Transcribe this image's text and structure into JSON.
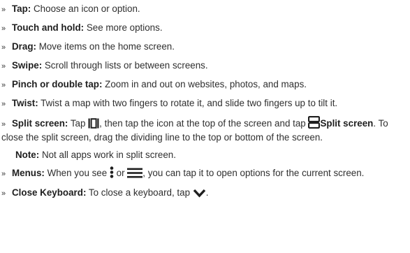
{
  "items": [
    {
      "bullet": "»",
      "term": "Tap:",
      "text": " Choose an icon or option."
    },
    {
      "bullet": "»",
      "term": "Touch and hold:",
      "text": " See more options."
    },
    {
      "bullet": "»",
      "term": "Drag:",
      "text": " Move items on the home screen."
    },
    {
      "bullet": "»",
      "term": "Swipe:",
      "text": " Scroll through lists or between screens."
    },
    {
      "bullet": "»",
      "term": "Pinch or double tap:",
      "text": " Zoom in and out on websites, photos, and maps."
    },
    {
      "bullet": "»",
      "term": "Twist:",
      "text": " Twist a map with two fingers to rotate it, and slide two fingers up to tilt it."
    }
  ],
  "split_screen": {
    "bullet": "»",
    "term": "Split screen:",
    "text_1": " Tap ",
    "text_2": ", then tap the icon at the top of the screen and tap ",
    "term_2": "Split screen",
    "text_3": ". To close the split screen, drag the dividing line to the top or bottom of the screen.",
    "icon_1": "recent-apps-icon",
    "icon_2": "split-screen-icon"
  },
  "note": {
    "label": "Note:",
    "text": " Not all apps work in split screen."
  },
  "menus": {
    "bullet": "»",
    "term": "Menus:",
    "text_1": " When you see ",
    "text_2": " or ",
    "text_3": ", you can tap it to open options for the current screen.",
    "icon_1": "more-vertical-icon",
    "icon_2": "menu-icon"
  },
  "close_keyboard": {
    "bullet": "»",
    "term": "Close Keyboard:",
    "text": " To close a keyboard, tap ",
    "text_end": ".",
    "icon": "chevron-down-icon"
  }
}
